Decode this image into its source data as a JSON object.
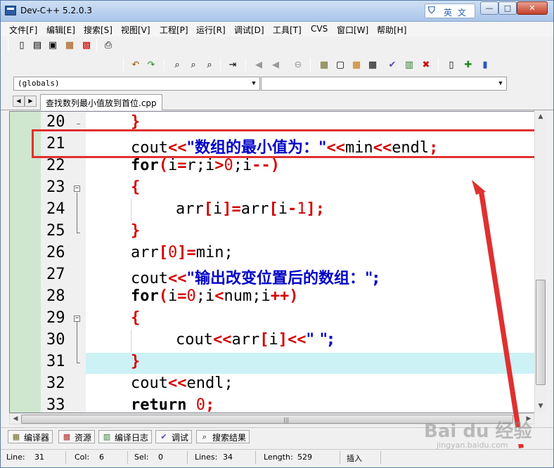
{
  "window": {
    "title": "Dev-C++ 5.2.0.3",
    "ime_label": "英 文",
    "controls": {
      "minimize": "—",
      "maximize": "□",
      "close": "✕"
    }
  },
  "menu": [
    "文件[F]",
    "编辑[E]",
    "搜索[S]",
    "视图[V]",
    "工程[P]",
    "运行[R]",
    "调试[D]",
    "工具[T]",
    "CVS",
    "窗口[W]",
    "帮助[H]"
  ],
  "combos": {
    "scope": "(globals)",
    "member": ""
  },
  "tabs": {
    "file": "查找数列最小值放到首位.cpp"
  },
  "editor": {
    "lines": [
      {
        "n": "20"
      },
      {
        "n": "21"
      },
      {
        "n": "22"
      },
      {
        "n": "23"
      },
      {
        "n": "24"
      },
      {
        "n": "25"
      },
      {
        "n": "26"
      },
      {
        "n": "27"
      },
      {
        "n": "28"
      },
      {
        "n": "29"
      },
      {
        "n": "30"
      },
      {
        "n": "31"
      },
      {
        "n": "32"
      },
      {
        "n": "33"
      }
    ],
    "code": {
      "l20_brace": "}",
      "l21_a": "cout",
      "l21_op1": "<<",
      "l21_q1": "\"",
      "l21_str": "数组的最小值为：",
      "l21_q2": "\"",
      "l21_op2": "<<",
      "l21_b": "min",
      "l21_op3": "<<",
      "l21_c": "endl",
      "l21_semi": ";",
      "l22_kw": "for",
      "l22_p1": "(",
      "l22_a": "i",
      "l22_eq": "=",
      "l22_b": "r;i",
      "l22_gt": ">",
      "l22_n": "0",
      "l22_c": ";i",
      "l22_dec": "--",
      "l22_p2": ")",
      "l23_brace": "{",
      "l24_a": "arr",
      "l24_b1": "[",
      "l24_i": "i",
      "l24_b2": "]",
      "l24_eq": "=",
      "l24_c": "arr",
      "l24_b3": "[",
      "l24_d": "i",
      "l24_minus": "-",
      "l24_n": "1",
      "l24_b4": "]",
      "l24_semi": ";",
      "l25_brace": "}",
      "l26_a": "arr",
      "l26_b1": "[",
      "l26_n": "0",
      "l26_b2": "]",
      "l26_eq": "=",
      "l26_c": "min;",
      "l27_a": "cout",
      "l27_op": "<<",
      "l27_q1": "\"",
      "l27_str": "输出改变位置后的数组：",
      "l27_q2": "\";",
      "l28_kw": "for",
      "l28_p1": "(",
      "l28_a": "i",
      "l28_eq": "=",
      "l28_n": "0",
      "l28_b": ";i",
      "l28_lt": "<",
      "l28_c": "num;i",
      "l28_inc": "++",
      "l28_p2": ")",
      "l29_brace": "{",
      "l30_a": "cout",
      "l30_op1": "<<",
      "l30_b": "arr",
      "l30_b1": "[",
      "l30_i": "i",
      "l30_b2": "]",
      "l30_op2": "<<",
      "l30_str": "\" \";",
      "l31_brace": "}",
      "l32_a": "cout",
      "l32_op": "<<",
      "l32_b": "endl;",
      "l33_kw": "return",
      "l33_n": "0",
      "l33_semi": ";"
    }
  },
  "panels": [
    "编译器",
    "资源",
    "编译日志",
    "调试",
    "搜索结果"
  ],
  "status": {
    "line_label": "Line:",
    "line": "31",
    "col_label": "Col:",
    "col": "6",
    "sel_label": "Sel:",
    "sel": "0",
    "lines_label": "Lines:",
    "lines": "34",
    "length_label": "Length:",
    "length": "529",
    "mode": "插入"
  },
  "watermark": {
    "main": "Bai du 经验",
    "sub": "jingyan.baidu.com"
  },
  "colors": {
    "operator": "#d40000",
    "string": "#0000c8",
    "annotation": "#e03030",
    "current_line": "#ccf2f6"
  }
}
